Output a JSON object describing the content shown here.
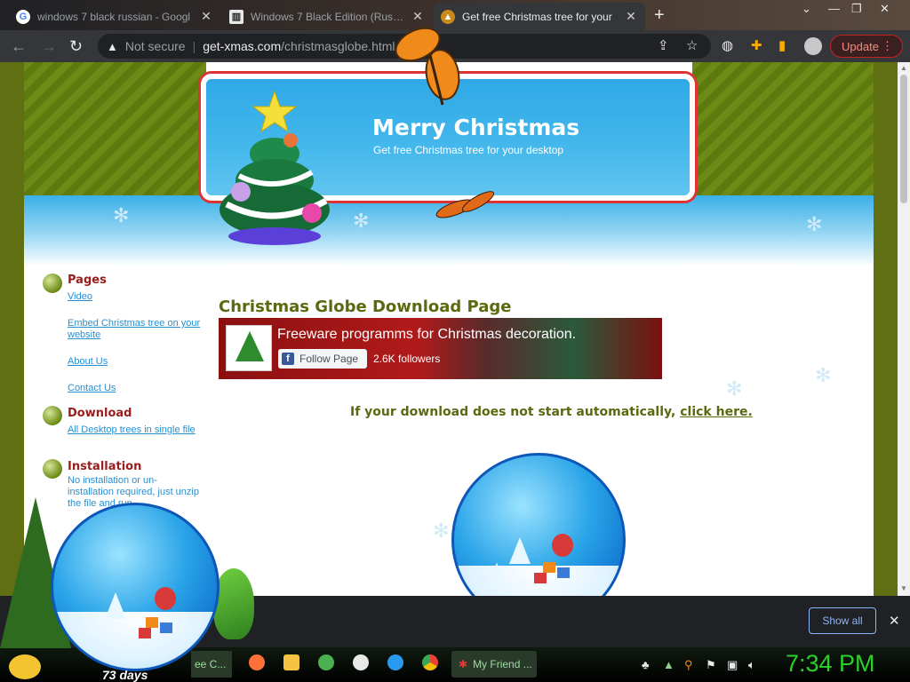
{
  "browser": {
    "tabs": [
      {
        "title": "windows 7 black russian - Googl",
        "favicon": "G",
        "active": false
      },
      {
        "title": "Windows 7 Black Edition (Russia",
        "favicon": "archive",
        "active": false
      },
      {
        "title": "Get free Christmas tree for your",
        "favicon": "tree",
        "active": true
      }
    ],
    "new_tab": "+",
    "security_label": "Not secure",
    "url_host": "get-xmas.com",
    "url_path": "/christmasglobe.html",
    "update_label": "Update"
  },
  "page": {
    "banner_title": "Merry Christmas",
    "banner_subtitle": "Get free Christmas tree for your desktop",
    "sidebar": {
      "pages_heading": "Pages",
      "pages_links": [
        "Video",
        "Embed Christmas tree on your website",
        "About Us",
        "Contact Us"
      ],
      "download_heading": "Download",
      "download_link": "All Desktop trees in single file",
      "install_heading": "Installation",
      "install_text": "No installation or un-installation required, just unzip the file and run."
    },
    "main_title": "Christmas Globe Download Page",
    "fb": {
      "title": "Freeware programms for Christmas decoration.",
      "follow_label": "Follow Page",
      "followers": "2.6K followers"
    },
    "download_prompt": "If your download does not start automatically,",
    "download_link": "click here."
  },
  "download_shelf": {
    "show_all": "Show all",
    "close": "✕"
  },
  "taskbar": {
    "xmas_task": "ee C...",
    "myfriend_task": "My Friend ...",
    "clock": "7:34 PM"
  },
  "desktop": {
    "globe_label": "73 days"
  },
  "colors": {
    "page_green": "#5f6f12",
    "sidebar_heading": "#9b1c1c",
    "link_blue": "#2a8fd0",
    "title_olive": "#5a6a10",
    "clock_green": "#2ad12a"
  }
}
